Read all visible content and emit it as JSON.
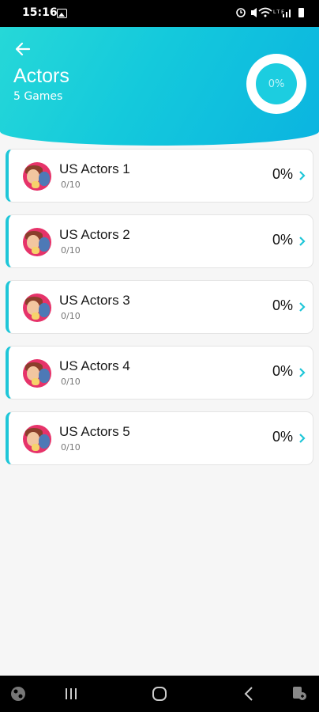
{
  "status_bar": {
    "time": "15:16",
    "right_icons": "⏰ 🔇 ᯤ ▮▮ ▮"
  },
  "header": {
    "title": "Actors",
    "subtitle": "5 Games",
    "progress": "0%",
    "gradient_colors": [
      "#26d8d8",
      "#0bb4e0"
    ]
  },
  "games": [
    {
      "title": "US Actors 1",
      "progress": "0/10",
      "percent": "0%"
    },
    {
      "title": "US Actors 2",
      "progress": "0/10",
      "percent": "0%"
    },
    {
      "title": "US Actors 3",
      "progress": "0/10",
      "percent": "0%"
    },
    {
      "title": "US Actors 4",
      "progress": "0/10",
      "percent": "0%"
    },
    {
      "title": "US Actors 5",
      "progress": "0/10",
      "percent": "0%"
    }
  ],
  "accent_color": "#1ec6d8",
  "nav_icons": [
    "app-icon",
    "recents-icon",
    "home-icon",
    "back-icon",
    "accessibility-icon"
  ]
}
